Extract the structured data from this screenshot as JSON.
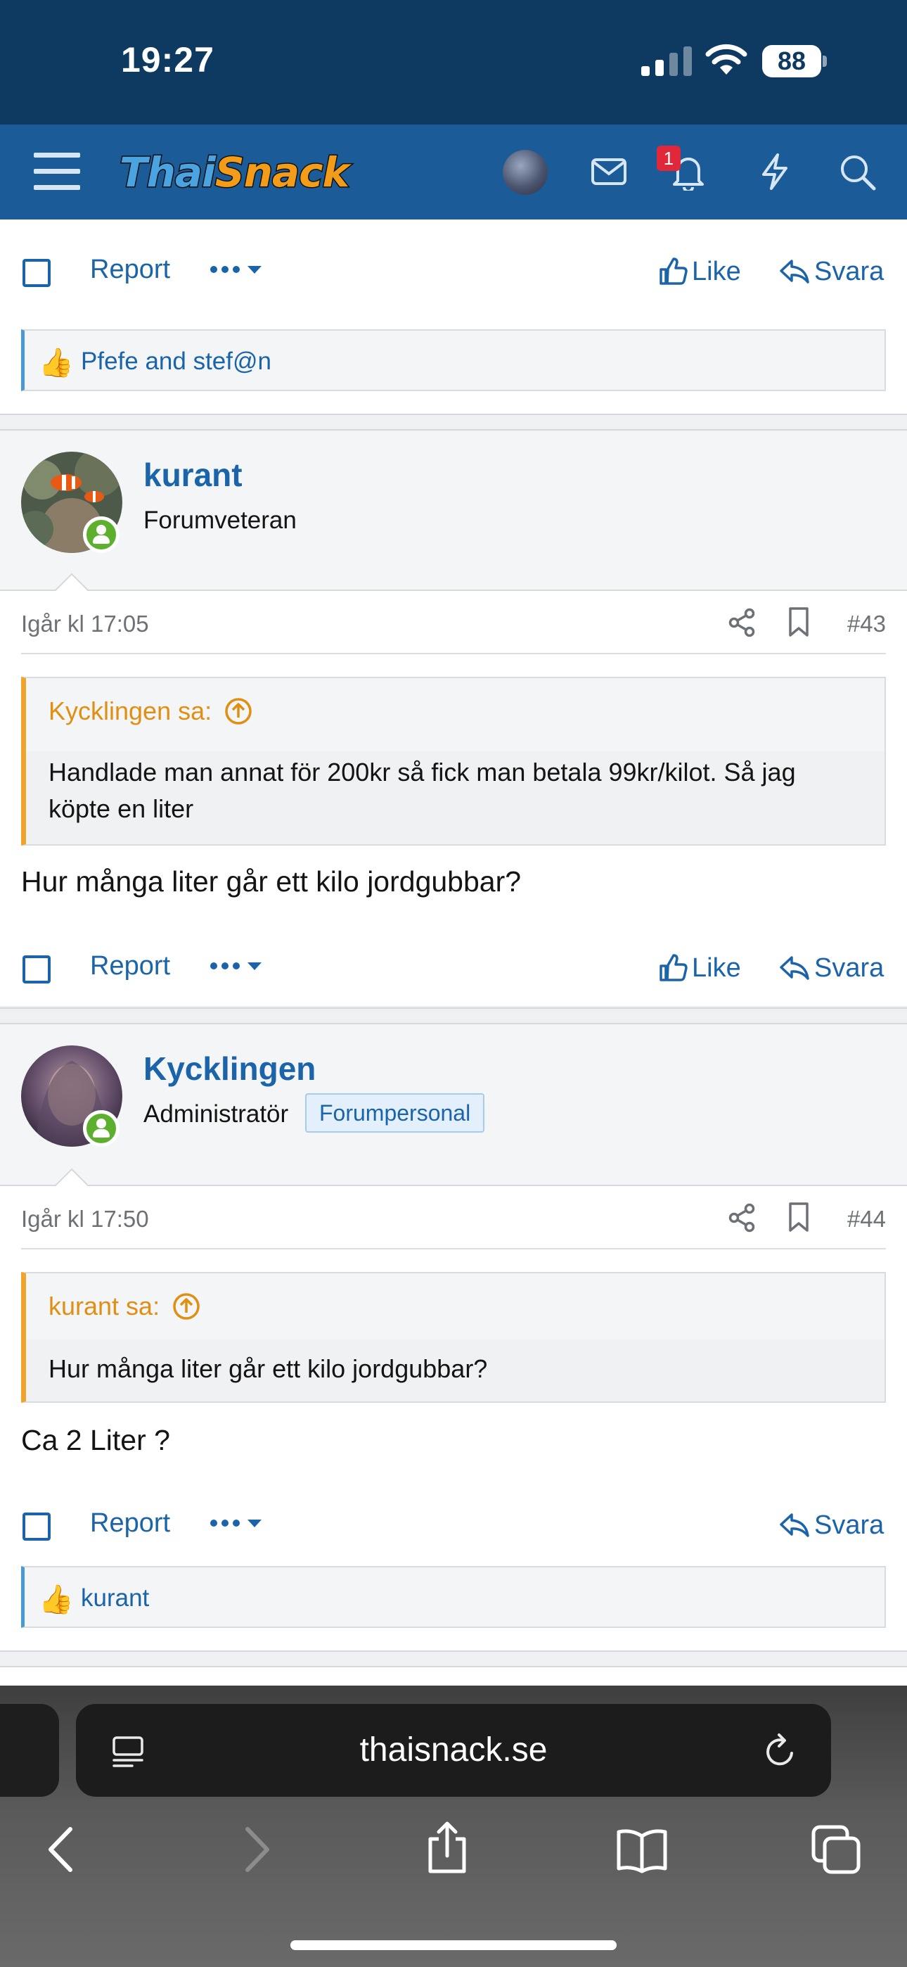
{
  "status_bar": {
    "time": "19:27",
    "battery": "88"
  },
  "header": {
    "logo_part1": "Thai",
    "logo_part2": "Snack",
    "notification_count": "1"
  },
  "top_post": {
    "actions": {
      "report": "Report",
      "like": "Like",
      "reply": "Svara"
    },
    "reactions": "Pfefe and stef@n"
  },
  "posts": [
    {
      "username": "kurant",
      "user_title": "Forumveteran",
      "time": "Igår kl 17:05",
      "post_number": "#43",
      "quote_author": "Kycklingen sa:",
      "quote_text": "Handlade man annat för 200kr så fick man betala 99kr/kilot. Så jag köpte en liter",
      "message": "Hur många liter går ett kilo jordgubbar?",
      "actions": {
        "report": "Report",
        "like": "Like",
        "reply": "Svara"
      }
    },
    {
      "username": "Kycklingen",
      "user_title": "Administratör",
      "staff_badge": "Forumpersonal",
      "time": "Igår kl 17:50",
      "post_number": "#44",
      "quote_author": "kurant sa:",
      "quote_text": "Hur många liter går ett kilo jordgubbar?",
      "message": "Ca 2 Liter ?",
      "actions": {
        "report": "Report",
        "reply": "Svara"
      },
      "reactions": "kurant"
    }
  ],
  "browser": {
    "url": "thaisnack.se"
  },
  "colors": {
    "header_bg": "#1b5c98",
    "status_bg": "#0e3a62",
    "link": "#1b64a9",
    "quote_accent": "#f0a42b",
    "online": "#5db02d"
  }
}
